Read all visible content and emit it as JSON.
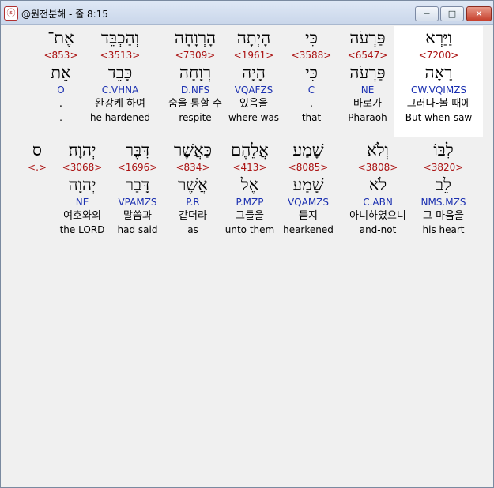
{
  "window": {
    "title": "@원전분해 - 줄 8:15",
    "app_icon_glyph": "ⓢ",
    "minimize_glyph": "─",
    "maximize_glyph": "□",
    "close_glyph": "✕"
  },
  "lines": [
    {
      "words": [
        {
          "heb": "וַיַּרְא",
          "strong": "<7200>",
          "lemma": "רָאָה",
          "morph": "CW.VQIMZS",
          "kor": "그러나-볼 때에",
          "eng": "But when-saw",
          "highlighted": true
        },
        {
          "heb": "פַּרְעֹה",
          "strong": "<6547>",
          "lemma": "פַּרְעֹה",
          "morph": "NE",
          "kor": "바로가",
          "eng": "Pharaoh"
        },
        {
          "heb": "כִּי",
          "strong": "<3588>",
          "lemma": "כִּי",
          "morph": "C",
          "kor": ".",
          "eng": "that"
        },
        {
          "heb": "הָיְתָה",
          "strong": "<1961>",
          "lemma": "הָיָה",
          "morph": "VQAFZS",
          "kor": "있음을",
          "eng": "where was"
        },
        {
          "heb": "הָרְוָחָה",
          "strong": "<7309>",
          "lemma": "רְוָחָה",
          "morph": "D.NFS",
          "kor": "숨을 통할 수",
          "eng": "respite"
        },
        {
          "heb": "וְהַכְבֵּד",
          "strong": "<3513>",
          "lemma": "כָּבֵד",
          "morph": "C.VHNA",
          "kor": "완강케 하여",
          "eng": "he hardened"
        },
        {
          "heb": "אֶת־",
          "strong": "<853>",
          "lemma": "אֵת",
          "morph": "O",
          "kor": ".",
          "eng": "."
        }
      ]
    },
    {
      "words": [
        {
          "heb": "לִבּוֹ",
          "strong": "<3820>",
          "lemma": "לֵב",
          "morph": "NMS.MZS",
          "kor": "그 마음을",
          "eng": "his heart"
        },
        {
          "heb": "וְלֹא",
          "strong": "<3808>",
          "lemma": "לֹא",
          "morph": "C.ABN",
          "kor": "아니하였으니",
          "eng": "and-not"
        },
        {
          "heb": "שָׁמַע",
          "strong": "<8085>",
          "lemma": "שָׁמַע",
          "morph": "VQAMZS",
          "kor": "듣지",
          "eng": "hearkened"
        },
        {
          "heb": "אֲלֵהֶם",
          "strong": "<413>",
          "lemma": "אֶל",
          "morph": "P.MZP",
          "kor": "그들을",
          "eng": "unto them"
        },
        {
          "heb": "כַּאֲשֶׁר",
          "strong": "<834>",
          "lemma": "אֲשֶׁר",
          "morph": "P.R",
          "kor": "같더라",
          "eng": "as"
        },
        {
          "heb": "דִּבֶּר",
          "strong": "<1696>",
          "lemma": "דָּבַר",
          "morph": "VPAMZS",
          "kor": "말씀과",
          "eng": "had said"
        },
        {
          "heb": "יְהוָה׃",
          "strong": "<3068>",
          "lemma": "יְהוָה",
          "morph": "NE",
          "kor": "여호와의",
          "eng": "the LORD"
        },
        {
          "heb": "ס",
          "strong": "<.>",
          "lemma": "",
          "morph": "",
          "kor": "",
          "eng": ""
        }
      ]
    }
  ]
}
